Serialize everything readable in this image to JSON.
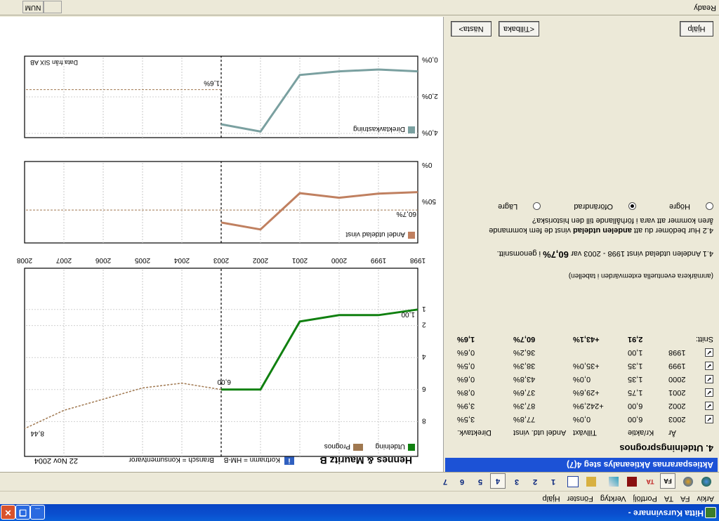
{
  "window": {
    "title": "Hitta Kursvinnare -"
  },
  "menu": [
    "Arkiv",
    "FA",
    "TA",
    "Portfölj",
    "Verktyg",
    "Fönster",
    "Hjälp"
  ],
  "toolbar": {
    "steps": [
      "1",
      "2",
      "3",
      "4",
      "5",
      "6",
      "7"
    ],
    "active_step": "4"
  },
  "left": {
    "panel_title": "Aktiespararnas Aktieanalys steg 4(7)",
    "section_title": "4. Utdelningsprognos",
    "headers": [
      "År",
      "Kr/aktie",
      "Tillväxt",
      "Andel utd. vinst",
      "Direktavk."
    ],
    "rows": [
      {
        "year": "2003",
        "kr": "6,00",
        "growth": "0,0%",
        "andel": "77,8%",
        "direkt": "3,5%"
      },
      {
        "year": "2002",
        "kr": "6,00",
        "growth": "+242,9%",
        "andel": "87,3%",
        "direkt": "3,9%"
      },
      {
        "year": "2001",
        "kr": "1,75",
        "growth": "+29,6%",
        "andel": "37,6%",
        "direkt": "0,8%"
      },
      {
        "year": "2000",
        "kr": "1,35",
        "growth": "0,0%",
        "andel": "43,8%",
        "direkt": "0,6%"
      },
      {
        "year": "1999",
        "kr": "1,35",
        "growth": "+35,0%",
        "andel": "38,3%",
        "direkt": "0,5%"
      },
      {
        "year": "1998",
        "kr": "1,00",
        "growth": "",
        "andel": "36,2%",
        "direkt": "0,6%"
      }
    ],
    "snitt": {
      "label": "Snitt:",
      "kr": "2,91",
      "growth": "+43,1%",
      "andel": "60,7%",
      "direkt": "1,6%"
    },
    "note": "(anmärkera eventuella extemvärden i tabellen)",
    "q41_pre": "4.1 Andelen utdelad vinst 1998 - 2003 var ",
    "q41_value": "60,7%",
    "q41_post": " i genomsnitt.",
    "q42_line1_pre": "4.2 Hur bedömer du att ",
    "q42_line1_bold": "andelen utdelad",
    "q42_line1_post": " vinst de fem kommande",
    "q42_line2": "åren kommer att vara i förhållande till den historiska?",
    "radio_options": [
      "Högre",
      "Oförändrad",
      "Lägre"
    ],
    "radio_selected": "Oförändrad",
    "buttons": {
      "help": "Hjälp",
      "back": "<Tillbaka",
      "next": "Nästa>"
    }
  },
  "right": {
    "company": "Hennes & Mauritz B",
    "kortnamn": "Kortnamn = HM-B",
    "bransch": "Bransch = Konsumentvaror",
    "date": "22 Nov 2004",
    "source": "Data från SIX AB"
  },
  "chart_data": [
    {
      "type": "line",
      "legend": "Direktavkastning",
      "x": [
        1998,
        1999,
        2000,
        2001,
        2002,
        2003
      ],
      "values": [
        0.6,
        0.5,
        0.6,
        0.8,
        3.9,
        3.5
      ],
      "yticks": [
        "0,0%",
        "2,0%",
        "4,0%"
      ],
      "ylim": [
        0,
        4
      ],
      "average_label": "1,6%",
      "average_value": 1.6,
      "color": "#7aa0a0"
    },
    {
      "type": "line",
      "legend": "Andel utdelad vinst",
      "x": [
        1998,
        1999,
        2000,
        2001,
        2002,
        2003
      ],
      "values": [
        36.2,
        38.3,
        43.8,
        37.6,
        87.3,
        77.8
      ],
      "yticks": [
        "0%",
        "50%"
      ],
      "ylim": [
        0,
        100
      ],
      "average_label": "60,7%",
      "average_value": 60.7,
      "color": "#c08060"
    },
    {
      "type": "line",
      "x_ticks": [
        "1998",
        "1999",
        "2000",
        "2001",
        "2002",
        "2003",
        "2004",
        "2005",
        "2006",
        "2007",
        "2008"
      ],
      "yticks": [
        "1",
        "2",
        "4",
        "6",
        "8"
      ],
      "series": [
        {
          "name": "Utdelning",
          "x": [
            1998,
            1999,
            2000,
            2001,
            2002,
            2003
          ],
          "values": [
            1.0,
            1.35,
            1.35,
            1.75,
            6.0,
            6.0
          ],
          "color": "#108010"
        },
        {
          "name": "Prognos",
          "x": [
            2003,
            2004,
            2005,
            2006,
            2007,
            2008
          ],
          "values": [
            6.0,
            5.6,
            5.9,
            6.6,
            7.3,
            8.44
          ],
          "color": "#a07850"
        }
      ],
      "point_labels": [
        "1,00",
        "6,00",
        "8,44"
      ]
    }
  ]
}
